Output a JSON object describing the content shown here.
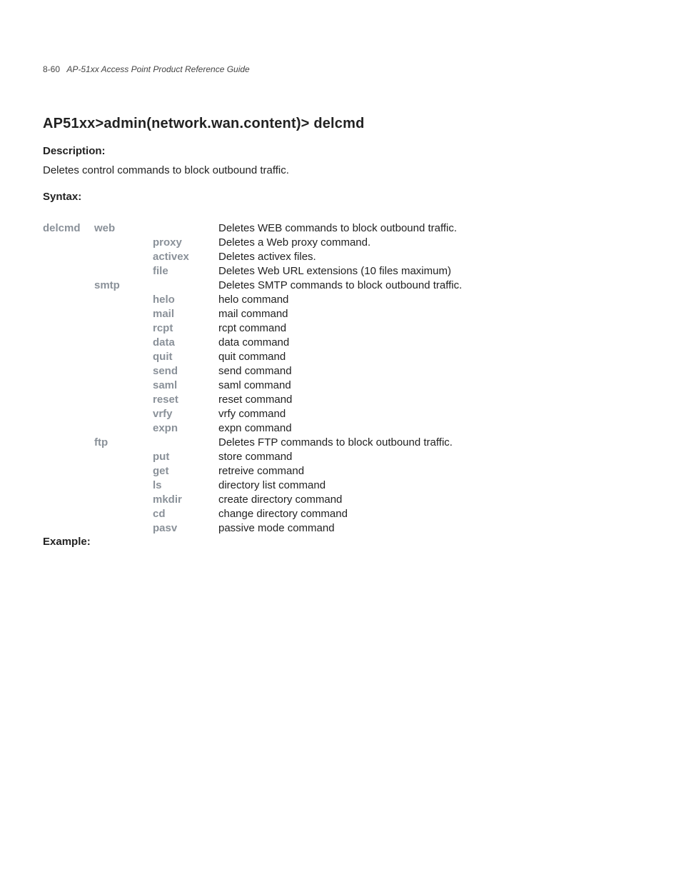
{
  "header": {
    "pageno": "8-60",
    "title": "AP-51xx Access Point Product Reference Guide"
  },
  "heading": "AP51xx>admin(network.wan.content)> delcmd",
  "sections": {
    "description_label": "Description:",
    "description_body": "Deletes control commands to block outbound traffic.",
    "syntax_label": "Syntax:",
    "example_label": "Example:"
  },
  "syntax": {
    "cmd": "delcmd",
    "groups": [
      {
        "name": "web",
        "desc": "Deletes WEB commands to block outbound traffic.",
        "subs": [
          {
            "name": "proxy",
            "desc": "Deletes a Web proxy command."
          },
          {
            "name": "activex",
            "desc": "Deletes activex files."
          },
          {
            "name": "file",
            "desc": "Deletes Web URL extensions (10 files maximum)"
          }
        ]
      },
      {
        "name": "smtp",
        "desc": "Deletes SMTP commands to block outbound traffic.",
        "subs": [
          {
            "name": "helo",
            "desc": "helo command"
          },
          {
            "name": "mail",
            "desc": "mail command"
          },
          {
            "name": "rcpt",
            "desc": "rcpt command"
          },
          {
            "name": "data",
            "desc": "data command"
          },
          {
            "name": "quit",
            "desc": "quit command"
          },
          {
            "name": "send",
            "desc": "send command"
          },
          {
            "name": "saml",
            "desc": "saml command"
          },
          {
            "name": "reset",
            "desc": "reset command"
          },
          {
            "name": "vrfy",
            "desc": "vrfy command"
          },
          {
            "name": "expn",
            "desc": "expn command"
          }
        ]
      },
      {
        "name": "ftp",
        "desc": "Deletes FTP commands to block outbound traffic.",
        "subs": [
          {
            "name": "put",
            "desc": "store command"
          },
          {
            "name": "get",
            "desc": "retreive command"
          },
          {
            "name": "ls",
            "desc": "directory list command"
          },
          {
            "name": "mkdir",
            "desc": "create directory command"
          },
          {
            "name": "cd",
            "desc": "change directory command"
          },
          {
            "name": "pasv",
            "desc": "passive mode command"
          }
        ]
      }
    ]
  }
}
